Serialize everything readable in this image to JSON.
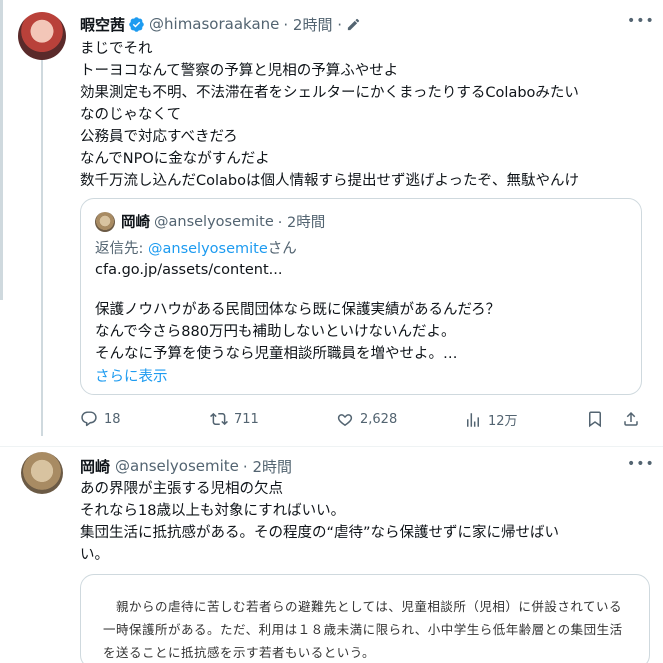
{
  "tweet": {
    "display_name": "暇空茜",
    "handle": "@himasoraakane",
    "time": "· 2時間 ·",
    "lines": [
      "まじでそれ",
      "トーヨコなんて警察の予算と児相の予算ふやせよ",
      "効果測定も不明、不法滞在者をシェルターにかくまったりするColaboみたい",
      "なのじゃなくて",
      "公務員で対応すべきだろ",
      "なんでNPOに金ながすんだよ",
      "数千万流し込んだColaboは個人情報すら提出せず逃げよったぞ、無駄やんけ"
    ],
    "quote": {
      "display_name": "岡崎",
      "handle": "@anselyosemite",
      "time": "· 2時間",
      "reply_prefix": "返信先: ",
      "reply_handle": "@anselyosemite",
      "reply_suffix": "さん",
      "link": "cfa.go.jp/assets/content...",
      "lines": [
        "保護ノウハウがある民間団体なら既に保護実績があるんだろ？",
        "なんで今さら880万円も補助しないといけないんだよ。",
        "そんなに予算を使うなら児童相談所職員を増やせよ。…"
      ],
      "show_more": "さらに表示"
    },
    "stats": {
      "replies": "18",
      "retweets": "711",
      "likes": "2,628",
      "views": "12万"
    }
  },
  "reply": {
    "display_name": "岡崎",
    "handle": "@anselyosemite",
    "time": "· 2時間",
    "lines": [
      "あの界隈が主張する児相の欠点",
      "それなら18歳以上も対象にすればいい。",
      "集団生活に抵抗感がある。その程度の“虐待”なら保護せずに家に帰せばい",
      "い。"
    ],
    "image_text": [
      "　親からの虐待に苦しむ若者らの避難先としては、児童相談所（児相）に併設されている",
      "一時保護所がある。ただ、利用は１８歳未満に限られ、小中学生ら低年齢層との集団生活",
      "を送ることに抵抗感を示す若者もいるという。"
    ]
  },
  "colors": {
    "text": "#0f1419",
    "muted": "#536471",
    "link": "#1d9bf0",
    "verified": "#1d9bf0",
    "border": "#cfd9de"
  }
}
